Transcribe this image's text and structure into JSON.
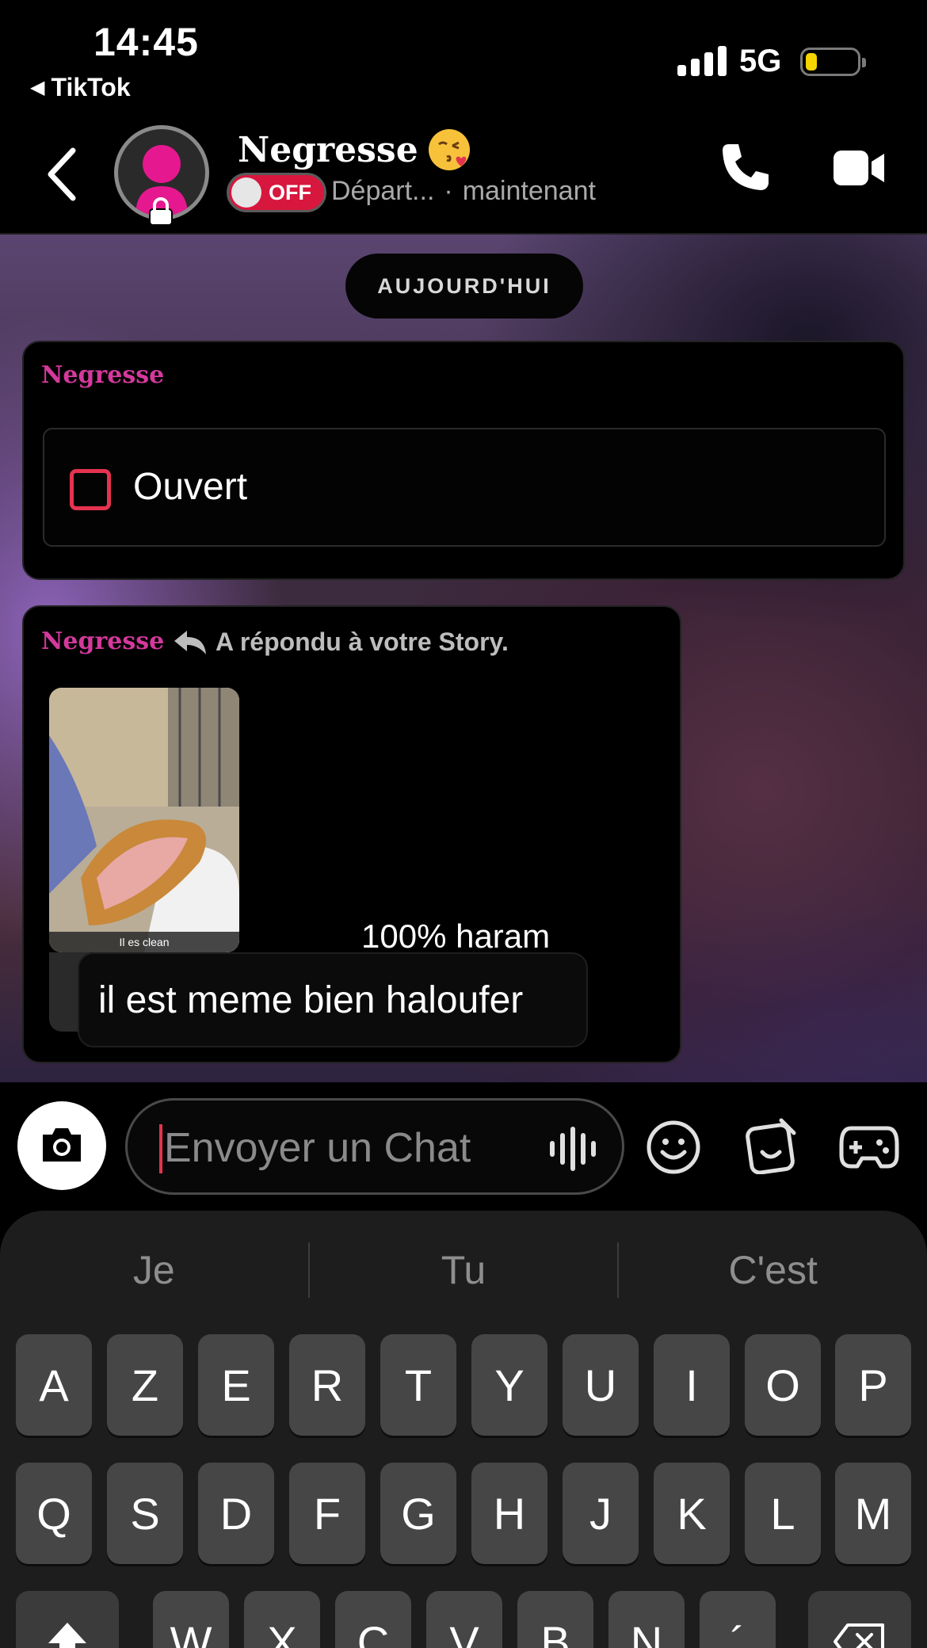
{
  "status_bar": {
    "time": "14:45",
    "back_app": "TikTok",
    "network": "5G",
    "battery_color": "#f5d400"
  },
  "header": {
    "contact_name": "Negresse",
    "name_emoji": "face-blowing-kiss",
    "toggle_label": "OFF",
    "location": "Départ...",
    "separator": "·",
    "last_seen": "maintenant",
    "icons": [
      "back-chevron-icon",
      "phone-icon",
      "video-camera-icon"
    ]
  },
  "chat": {
    "date_pill": "AUJOURD'HUI",
    "card1": {
      "sender": "Negresse",
      "snap_label": "Ouvert"
    },
    "card2": {
      "sender": "Negresse",
      "reply_note": "A répondu à votre Story.",
      "story_caption": "Il es clean",
      "story_overlay_text": "100% haram",
      "reply_text": "il est meme bien haloufer"
    },
    "sender_color": "#d4399c",
    "snap_color": "#e5334f"
  },
  "input": {
    "placeholder": "Envoyer un Chat",
    "icons": [
      "camera-icon",
      "voice-wave-icon",
      "emoji-icon",
      "sticker-icon",
      "game-controller-icon"
    ]
  },
  "keyboard": {
    "suggestions": [
      "Je",
      "Tu",
      "C'est"
    ],
    "row1": [
      "A",
      "Z",
      "E",
      "R",
      "T",
      "Y",
      "U",
      "I",
      "O",
      "P"
    ],
    "row2": [
      "Q",
      "S",
      "D",
      "F",
      "G",
      "H",
      "J",
      "K",
      "L",
      "M"
    ],
    "row3": [
      "W",
      "X",
      "C",
      "V",
      "B",
      "N",
      "´"
    ]
  }
}
